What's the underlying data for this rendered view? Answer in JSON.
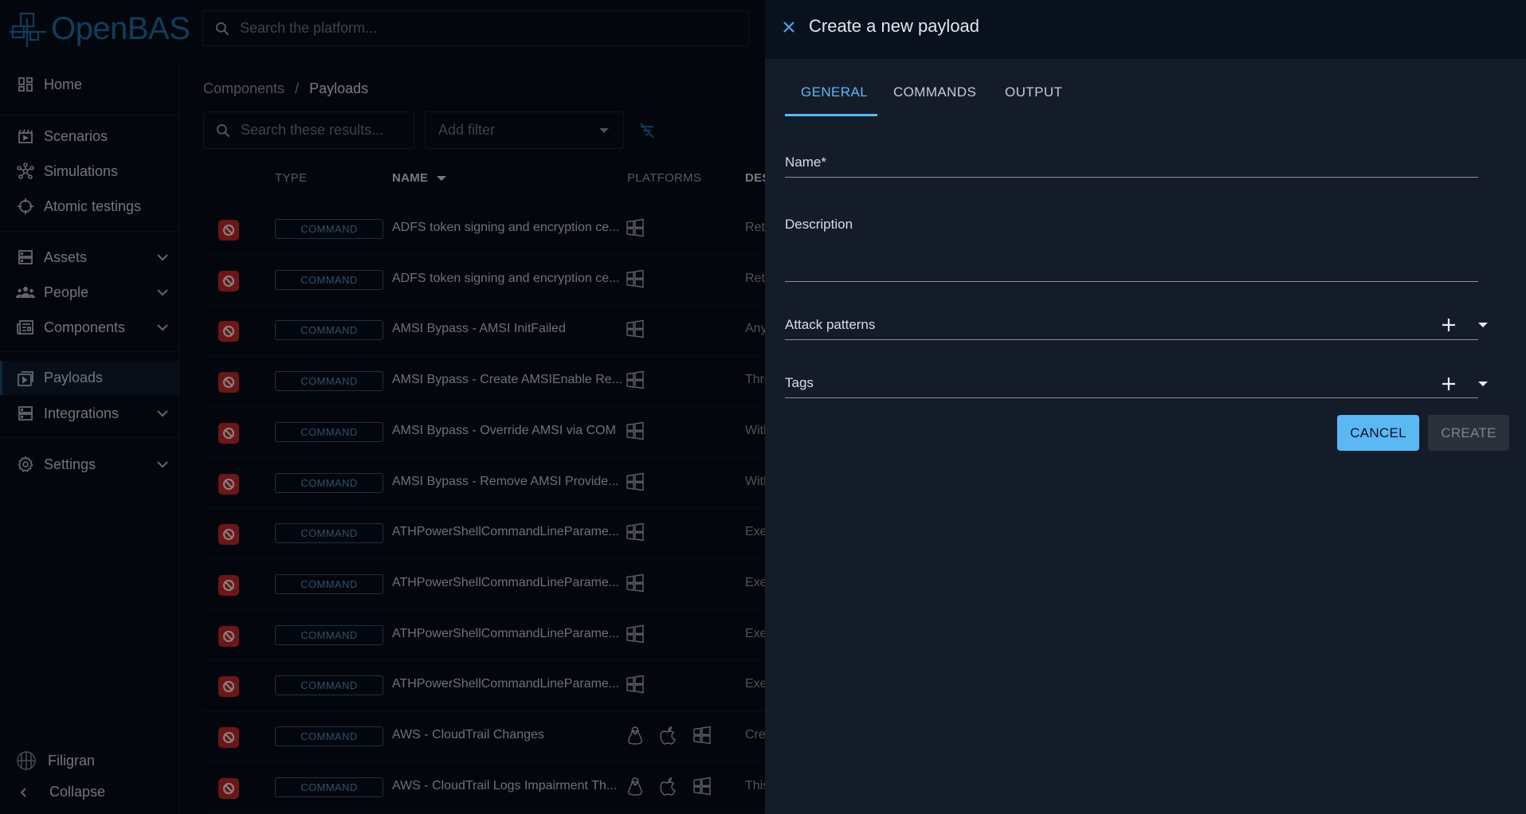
{
  "app": {
    "logo_text": "OpenBAS"
  },
  "global_search": {
    "placeholder": "Search the platform..."
  },
  "sidebar": {
    "items": [
      {
        "label": "Home",
        "icon": "home-grid-icon"
      },
      {
        "label": "Scenarios",
        "icon": "clapperboard-icon"
      },
      {
        "label": "Simulations",
        "icon": "hub-icon"
      },
      {
        "label": "Atomic testings",
        "icon": "crosshair-icon"
      },
      {
        "label": "Assets",
        "icon": "server-icon"
      },
      {
        "label": "People",
        "icon": "people-icon"
      },
      {
        "label": "Components",
        "icon": "newspaper-icon"
      },
      {
        "label": "Payloads",
        "icon": "payload-icon"
      },
      {
        "label": "Integrations",
        "icon": "server-icon"
      },
      {
        "label": "Settings",
        "icon": "gear-icon"
      }
    ],
    "footer_brand": "Filigran",
    "collapse_label": "Collapse"
  },
  "breadcrumb": {
    "parent": "Components",
    "separator": "/",
    "current": "Payloads"
  },
  "list": {
    "search_placeholder": "Search these results...",
    "filter_placeholder": "Add filter",
    "headers": {
      "type": "TYPE",
      "name": "NAME",
      "platforms": "PLATFORMS",
      "description": "DES"
    },
    "rows": [
      {
        "type": "COMMAND",
        "name": "ADFS token signing and encryption ce...",
        "platforms": [
          "windows"
        ],
        "desc": "Retr"
      },
      {
        "type": "COMMAND",
        "name": "ADFS token signing and encryption ce...",
        "platforms": [
          "windows"
        ],
        "desc": "Retr"
      },
      {
        "type": "COMMAND",
        "name": "AMSI Bypass - AMSI InitFailed",
        "platforms": [
          "windows"
        ],
        "desc": "Any"
      },
      {
        "type": "COMMAND",
        "name": "AMSI Bypass - Create AMSIEnable Re...",
        "platforms": [
          "windows"
        ],
        "desc": "Thro"
      },
      {
        "type": "COMMAND",
        "name": "AMSI Bypass - Override AMSI via COM",
        "platforms": [
          "windows"
        ],
        "desc": "With"
      },
      {
        "type": "COMMAND",
        "name": "AMSI Bypass - Remove AMSI Provide...",
        "platforms": [
          "windows"
        ],
        "desc": "With"
      },
      {
        "type": "COMMAND",
        "name": "ATHPowerShellCommandLineParame...",
        "platforms": [
          "windows"
        ],
        "desc": "Exe"
      },
      {
        "type": "COMMAND",
        "name": "ATHPowerShellCommandLineParame...",
        "platforms": [
          "windows"
        ],
        "desc": "Exe"
      },
      {
        "type": "COMMAND",
        "name": "ATHPowerShellCommandLineParame...",
        "platforms": [
          "windows"
        ],
        "desc": "Exe"
      },
      {
        "type": "COMMAND",
        "name": "ATHPowerShellCommandLineParame...",
        "platforms": [
          "windows"
        ],
        "desc": "Exe"
      },
      {
        "type": "COMMAND",
        "name": "AWS - CloudTrail Changes",
        "platforms": [
          "linux",
          "macos",
          "windows"
        ],
        "desc": "Crea"
      },
      {
        "type": "COMMAND",
        "name": "AWS - CloudTrail Logs Impairment Th...",
        "platforms": [
          "linux",
          "macos",
          "windows"
        ],
        "desc": "This"
      }
    ]
  },
  "drawer": {
    "title": "Create a new payload",
    "tabs": [
      "GENERAL",
      "COMMANDS",
      "OUTPUT"
    ],
    "active_tab": "GENERAL",
    "fields": {
      "name_label": "Name",
      "name_required_mark": "*",
      "description_label": "Description",
      "attack_patterns_label": "Attack patterns",
      "tags_label": "Tags"
    },
    "buttons": {
      "cancel": "CANCEL",
      "create": "CREATE"
    }
  },
  "colors": {
    "accent": "#5cb8f3",
    "brand": "#1e6fa6",
    "danger": "#c62828",
    "background": "#070d19",
    "drawer": "#151c29"
  }
}
